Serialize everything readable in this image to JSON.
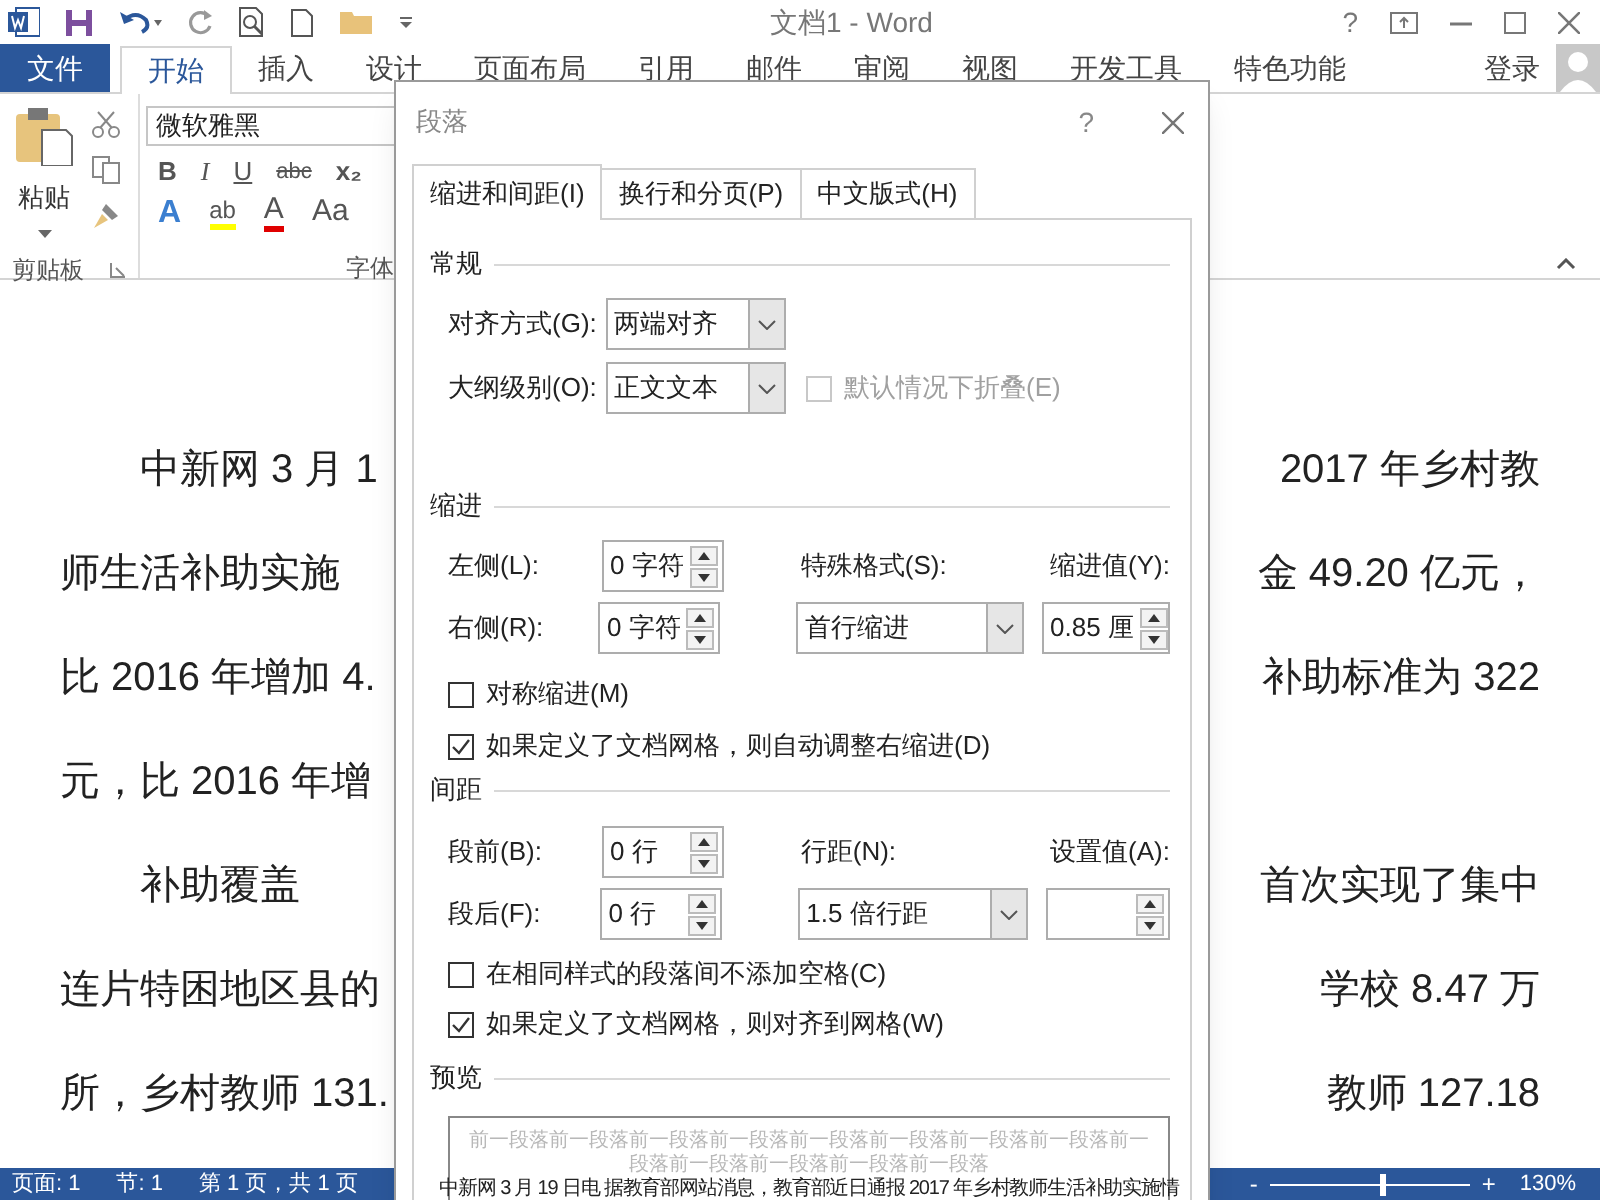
{
  "window": {
    "title": "文档1 - Word",
    "help": "?"
  },
  "ribbon_tabs": [
    {
      "label": "文件",
      "kind": "file",
      "selected": false
    },
    {
      "label": "开始",
      "kind": "tab",
      "selected": true
    },
    {
      "label": "插入",
      "kind": "tab",
      "selected": false
    },
    {
      "label": "设计",
      "kind": "tab",
      "selected": false
    },
    {
      "label": "页面布局",
      "kind": "tab",
      "selected": false
    },
    {
      "label": "引用",
      "kind": "tab",
      "selected": false
    },
    {
      "label": "邮件",
      "kind": "tab",
      "selected": false
    },
    {
      "label": "审阅",
      "kind": "tab",
      "selected": false
    },
    {
      "label": "视图",
      "kind": "tab",
      "selected": false
    },
    {
      "label": "开发工具",
      "kind": "tab",
      "selected": false
    },
    {
      "label": "特色功能",
      "kind": "tab",
      "selected": false
    }
  ],
  "account": {
    "label": "登录"
  },
  "ribbon": {
    "paste_label": "粘贴",
    "font_name": "微软雅黑",
    "format_buttons": [
      "B",
      "I",
      "U",
      "abc",
      "x₂"
    ],
    "style_buttons": [
      {
        "label": "A",
        "kind": "effects"
      },
      {
        "label": "ab",
        "kind": "highlight"
      },
      {
        "label": "A",
        "kind": "color"
      },
      {
        "label": "Aa",
        "kind": "case"
      }
    ],
    "groups": [
      "剪贴板",
      "字体"
    ]
  },
  "document": {
    "lines": [
      {
        "left": "中新网 3 月 1",
        "right": "2017 年乡村教",
        "indent": true
      },
      {
        "left": "师生活补助实施",
        "right": "金 49.20 亿元，",
        "indent": false
      },
      {
        "left": "比 2016 年增加 4.",
        "right": "补助标准为 322",
        "indent": false
      },
      {
        "left": "元，比 2016 年增",
        "indent": false
      },
      {
        "left": "补助覆盖",
        "right": "首次实现了集中",
        "indent": true
      },
      {
        "left": "连片特困地区县的",
        "right": "学校 8.47 万",
        "indent": false
      },
      {
        "left": "所，乡村教师 131.",
        "right": "教师 127.18",
        "indent": false
      }
    ]
  },
  "status_bar": {
    "items": [
      "页面: 1",
      "节: 1",
      "第 1 页，共 1 页"
    ],
    "zoom_out": "-",
    "zoom_in": "+",
    "zoom": "130%",
    "level": 0.55
  },
  "dialog": {
    "title": "段落",
    "help": "?",
    "tabs": [
      {
        "label": "缩进和间距(I)",
        "selected": true
      },
      {
        "label": "换行和分页(P)",
        "selected": false
      },
      {
        "label": "中文版式(H)",
        "selected": false
      }
    ],
    "general": {
      "heading": "常规",
      "alignment": {
        "label": "对齐方式(G):",
        "value": "两端对齐"
      },
      "outline_level": {
        "label": "大纲级别(O):",
        "value": "正文文本"
      },
      "collapse": {
        "label": "默认情况下折叠(E)",
        "checked": false,
        "disabled": true
      }
    },
    "indentation": {
      "heading": "缩进",
      "left": {
        "label": "左侧(L):",
        "value": "0 字符"
      },
      "right": {
        "label": "右侧(R):",
        "value": "0 字符"
      },
      "special": {
        "label": "特殊格式(S):",
        "value": "首行缩进"
      },
      "by": {
        "label": "缩进值(Y):",
        "value": "0.85 厘"
      },
      "mirror": {
        "label": "对称缩进(M)",
        "checked": false,
        "disabled": false
      },
      "auto_adjust": {
        "label": "如果定义了文档网格，则自动调整右缩进(D)",
        "checked": true,
        "disabled": false
      }
    },
    "spacing": {
      "heading": "间距",
      "before": {
        "label": "段前(B):",
        "value": "0 行"
      },
      "after": {
        "label": "段后(F):",
        "value": "0 行"
      },
      "line_spacing": {
        "label": "行距(N):",
        "value": "1.5 倍行距"
      },
      "at": {
        "label": "设置值(A):"
      },
      "dont_add": {
        "label": "在相同样式的段落间不添加空格(C)",
        "checked": false,
        "disabled": false
      },
      "snap": {
        "label": "如果定义了文档网格，则对齐到网格(W)",
        "checked": true,
        "disabled": false
      }
    },
    "preview": {
      "heading": "预览",
      "previous_text": [
        "前一段落前一段落前一段落前一段落前一段落前一段落前一段落前一段落前一",
        "段落前一段落前一段落前一段落前一段落"
      ],
      "current_text": "中新网 3 月 19 日电 据教育部网站消息，教育部近日通报 2017 年乡村教师生活补助实施情"
    }
  }
}
